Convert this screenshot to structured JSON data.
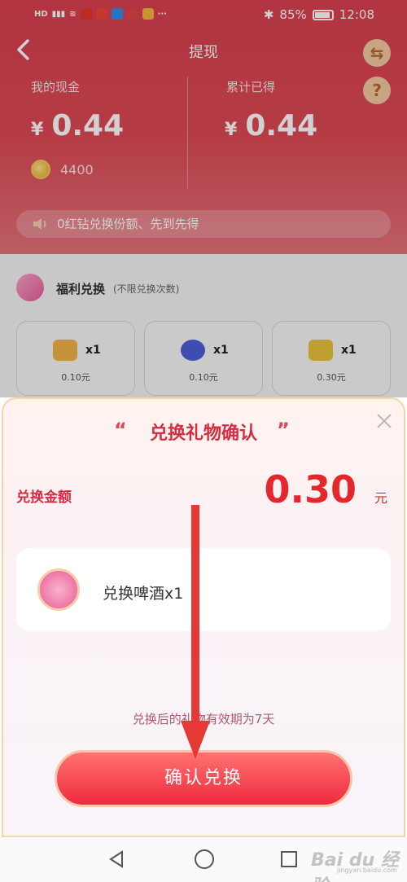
{
  "status_bar": {
    "left_text": "HD",
    "battery": "85%",
    "time": "12:08"
  },
  "header": {
    "title": "提现"
  },
  "balance": {
    "cash_label": "我的现金",
    "cash_symbol": "¥",
    "cash_value": "0.44",
    "earned_label": "累计已得",
    "earned_symbol": "¥",
    "earned_value": "0.44",
    "coins": "4400"
  },
  "notice": "0红钻兑换份额、先到先得",
  "welfare": {
    "title": "福利兑换",
    "subtitle": "(不限兑换次数)",
    "items": [
      {
        "qty": "x1",
        "price": "0.10元",
        "color": "#f2b24a"
      },
      {
        "qty": "x1",
        "price": "0.10元",
        "color": "#4c5fd6"
      },
      {
        "qty": "x1",
        "price": "0.30元",
        "color": "#e9c33b"
      }
    ]
  },
  "popup": {
    "title": "兑换礼物确认",
    "quote_left": "“",
    "quote_right": "”",
    "amount_label": "兑换金额",
    "amount_value": "0.30",
    "amount_unit": "元",
    "item_text": "兑换啤酒x1",
    "validity": "兑换后的礼物有效期为7天",
    "confirm_label": "确认兑换"
  },
  "watermark": {
    "text": "Bai du 经验",
    "sub": "jingyan.baidu.com"
  },
  "colors": {
    "brand_red": "#d9404f",
    "accent_red": "#e5262c",
    "annotation_red": "#e53935"
  }
}
